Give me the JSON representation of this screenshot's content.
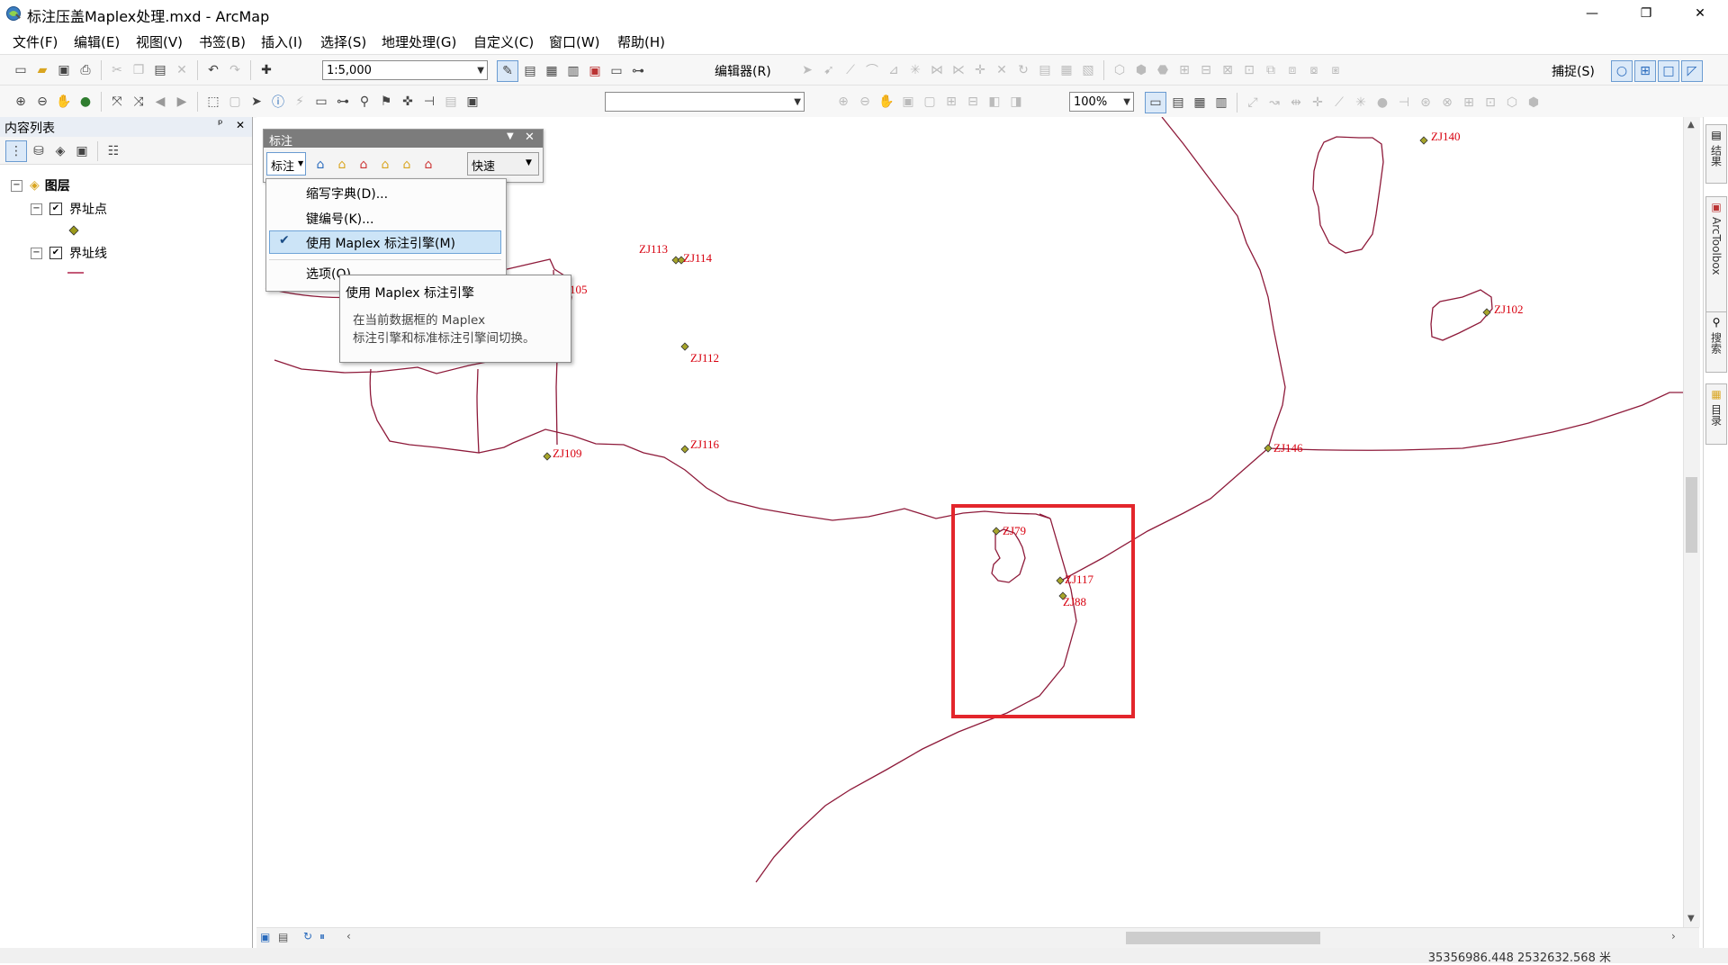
{
  "window": {
    "title": "标注压盖Maplex处理.mxd - ArcMap",
    "minimize_glyph": "—",
    "restore_glyph": "❐",
    "close_glyph": "✕"
  },
  "menu": [
    "文件(F)",
    "编辑(E)",
    "视图(V)",
    "书签(B)",
    "插入(I)",
    "选择(S)",
    "地理处理(G)",
    "自定义(C)",
    "窗口(W)",
    "帮助(H)"
  ],
  "toolbar": {
    "scale": "1:5,000",
    "editor_label": "编辑器(R)",
    "snapping_label": "捕捉(S)",
    "zoom_percent": "100%",
    "georef_layer": ""
  },
  "toc": {
    "title": "内容列表",
    "pin_glyph": "ᵖ",
    "close_glyph": "✕",
    "root": "图层",
    "layers": [
      {
        "name": "界址点",
        "checked": true
      },
      {
        "name": "界址线",
        "checked": true
      }
    ]
  },
  "labeling_toolbar": {
    "title": "标注",
    "dropdown_label": "标注",
    "quick_label": "快速"
  },
  "label_menu": {
    "items": [
      "缩写字典(D)...",
      "键编号(K)...",
      "使用 Maplex 标注引擎(M)",
      "选项(O)..."
    ],
    "checked_item": "使用 Maplex 标注引擎(M)"
  },
  "tooltip": {
    "title": "使用 Maplex 标注引擎",
    "line1": "在当前数据框的 Maplex",
    "line2": "标注引擎和标准标注引擎间切换。"
  },
  "map": {
    "line_color": "#8e1a3a",
    "label_color": "#d8000f",
    "highlight_color": "#e3262c",
    "point_labels": [
      "ZJ140",
      "ZJ102",
      "ZJ113",
      "ZJ114",
      "ZJ112",
      "ZJ116",
      "ZJ109",
      "ZJ146",
      "ZJ79",
      "ZJ117",
      "ZJ88",
      "105"
    ]
  },
  "right_dock": [
    "结果",
    "ArcToolbox",
    "搜索",
    "目录"
  ],
  "status": {
    "coordinates": "35356986.448  2532632.568 米"
  }
}
